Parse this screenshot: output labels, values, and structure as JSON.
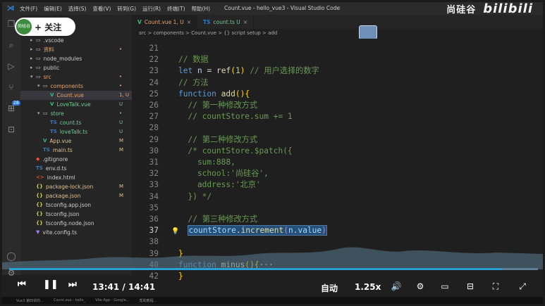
{
  "titlebar": {
    "menu": [
      "文件(F)",
      "编辑(E)",
      "选择(S)",
      "查看(V)",
      "转到(G)",
      "运行(R)",
      "终端(T)",
      "帮助(H)"
    ],
    "window_title": "Count.vue - hello_vue3 - Visual Studio Code",
    "brand_cn": "尚硅谷",
    "brand_en": "bilibili"
  },
  "follow": {
    "label": "+ 关注",
    "avatar_text": "尚硅谷"
  },
  "activity_badge": "28",
  "explorer": {
    "items": [
      {
        "name": ".vscode",
        "type": "folder",
        "indent": 0,
        "status": ""
      },
      {
        "name": "资料",
        "type": "folder",
        "indent": 0,
        "status": "•",
        "color": "#e8a56a"
      },
      {
        "name": "node_modules",
        "type": "folder",
        "indent": 0,
        "status": ""
      },
      {
        "name": "public",
        "type": "folder",
        "indent": 0,
        "status": ""
      },
      {
        "name": "src",
        "type": "folder-open",
        "indent": 0,
        "status": "•",
        "color": "#e8a56a"
      },
      {
        "name": "components",
        "type": "folder-open",
        "indent": 1,
        "status": "•",
        "color": "#e8a56a"
      },
      {
        "name": "Count.vue",
        "type": "vue",
        "indent": 2,
        "status": "1, U",
        "color": "#e8a56a",
        "selected": true
      },
      {
        "name": "LoveTalk.vue",
        "type": "vue",
        "indent": 2,
        "status": "U",
        "color": "#73c991"
      },
      {
        "name": "store",
        "type": "folder-open",
        "indent": 1,
        "status": "•",
        "color": "#73c991"
      },
      {
        "name": "count.ts",
        "type": "ts",
        "indent": 2,
        "status": "U",
        "color": "#73c991"
      },
      {
        "name": "loveTalk.ts",
        "type": "ts",
        "indent": 2,
        "status": "U",
        "color": "#73c991"
      },
      {
        "name": "App.vue",
        "type": "vue",
        "indent": 1,
        "status": "M",
        "color": "#e2c08d"
      },
      {
        "name": "main.ts",
        "type": "ts",
        "indent": 1,
        "status": "M",
        "color": "#e2c08d"
      },
      {
        "name": ".gitignore",
        "type": "git",
        "indent": 0,
        "status": ""
      },
      {
        "name": "env.d.ts",
        "type": "ts",
        "indent": 0,
        "status": ""
      },
      {
        "name": "index.html",
        "type": "html",
        "indent": 0,
        "status": ""
      },
      {
        "name": "package-lock.json",
        "type": "json",
        "indent": 0,
        "status": "M",
        "color": "#e2c08d"
      },
      {
        "name": "package.json",
        "type": "json",
        "indent": 0,
        "status": "M",
        "color": "#e2c08d"
      },
      {
        "name": "tsconfig.app.json",
        "type": "json",
        "indent": 0,
        "status": ""
      },
      {
        "name": "tsconfig.json",
        "type": "json",
        "indent": 0,
        "status": ""
      },
      {
        "name": "tsconfig.node.json",
        "type": "json",
        "indent": 0,
        "status": ""
      },
      {
        "name": "vite.config.ts",
        "type": "vite",
        "indent": 0,
        "status": ""
      }
    ]
  },
  "tabs": [
    {
      "label": "Count.vue 1, U",
      "active": true
    },
    {
      "label": "count.ts U",
      "active": false
    }
  ],
  "breadcrumb": "src > components > Count.vue > {} script setup > add",
  "code_lines": [
    {
      "n": "21",
      "html": ""
    },
    {
      "n": "22",
      "html": "<span class='cm'>// 数据</span>"
    },
    {
      "n": "23",
      "html": "<span class='kw'>let</span> <span class='var'>n</span> <span class='pl'>=</span> <span class='fn'>ref</span><span class='br'>(</span><span class='num'>1</span><span class='br'>)</span> <span class='cm'>// 用户选择的数字</span>"
    },
    {
      "n": "24",
      "html": "<span class='cm'>// 方法</span>"
    },
    {
      "n": "25",
      "html": "<span class='kw'>function</span> <span class='fn'>add</span><span class='br'>()</span><span class='br'>{</span>"
    },
    {
      "n": "26",
      "html": "  <span class='cm'>// 第一种修改方式</span>"
    },
    {
      "n": "27",
      "html": "  <span class='cm'>// countStore.sum += 1</span>"
    },
    {
      "n": "28",
      "html": ""
    },
    {
      "n": "29",
      "html": "  <span class='cm'>// 第二种修改方式</span>"
    },
    {
      "n": "30",
      "html": "  <span class='cm'>/* countStore.$patch({</span>"
    },
    {
      "n": "31",
      "html": "<span class='cm'>    sum:888,</span>"
    },
    {
      "n": "32",
      "html": "<span class='cm'>    school:'尚硅谷',</span>"
    },
    {
      "n": "33",
      "html": "<span class='cm'>    address:'北京'</span>"
    },
    {
      "n": "34",
      "html": "<span class='cm'>  }) */</span>"
    },
    {
      "n": "35",
      "html": ""
    },
    {
      "n": "36",
      "html": "  <span class='cm'>// 第三种修改方式</span>"
    },
    {
      "n": "37",
      "html": "  <span class='hl'><span class='var'>countStore</span><span class='pl'>.</span><span class='fn'>increment</span><span class='br2'>(</span><span class='var'>n</span><span class='pl'>.</span><span class='var'>value</span><span class='br2'>)</span></span>",
      "current": true
    },
    {
      "n": "38",
      "html": ""
    },
    {
      "n": "39",
      "html": "<span class='br'>}</span>"
    },
    {
      "n": "40",
      "html": "<span class='kw'>function</span> <span class='fn'>minus</span><span class='br'>()</span><span class='br'>{</span><span class='pl'>···</span>"
    },
    {
      "n": "42",
      "html": "<span class='br'>}</span>"
    }
  ],
  "player": {
    "current_time": "13:41",
    "total_time": "14:41",
    "time_sep": "/",
    "quality": "自动",
    "speed": "1.25x",
    "progress_fraction": 0.932
  },
  "taskbar": [
    "Vue3 第四讲的...",
    "Count.vue - hello_",
    "Vite App - Google...",
    "帮助教程..."
  ]
}
